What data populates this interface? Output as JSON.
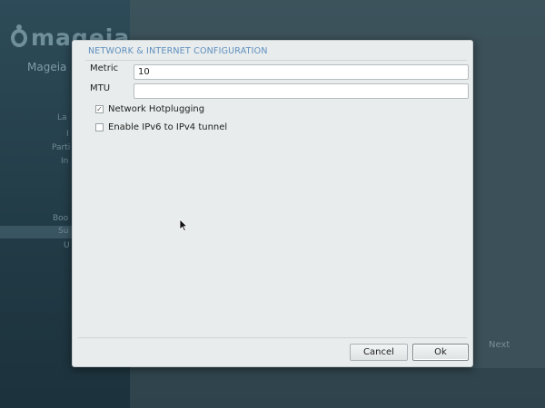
{
  "background": {
    "logo_text": "mageia",
    "sidebar_title": "Mageia",
    "sidebar_items": [
      "La",
      "I",
      "Parti",
      "In",
      "Boo",
      "Su",
      "U"
    ],
    "next_label": "Next"
  },
  "dialog": {
    "title": "NETWORK & INTERNET CONFIGURATION",
    "metric": {
      "label": "Metric",
      "value": "10"
    },
    "mtu": {
      "label": "MTU",
      "value": ""
    },
    "checkboxes": [
      {
        "label": "Network Hotplugging",
        "checked": true
      },
      {
        "label": "Enable IPv6 to IPv4 tunnel",
        "checked": false
      }
    ],
    "cancel_label": "Cancel",
    "ok_label": "Ok"
  },
  "colors": {
    "title_accent": "#5f8fbf",
    "dialog_bg": "#e8ecec",
    "sidebar_bg": "#2d4b58"
  },
  "icons": {
    "check": "✓",
    "cursor": "arrow-pointer-icon"
  }
}
